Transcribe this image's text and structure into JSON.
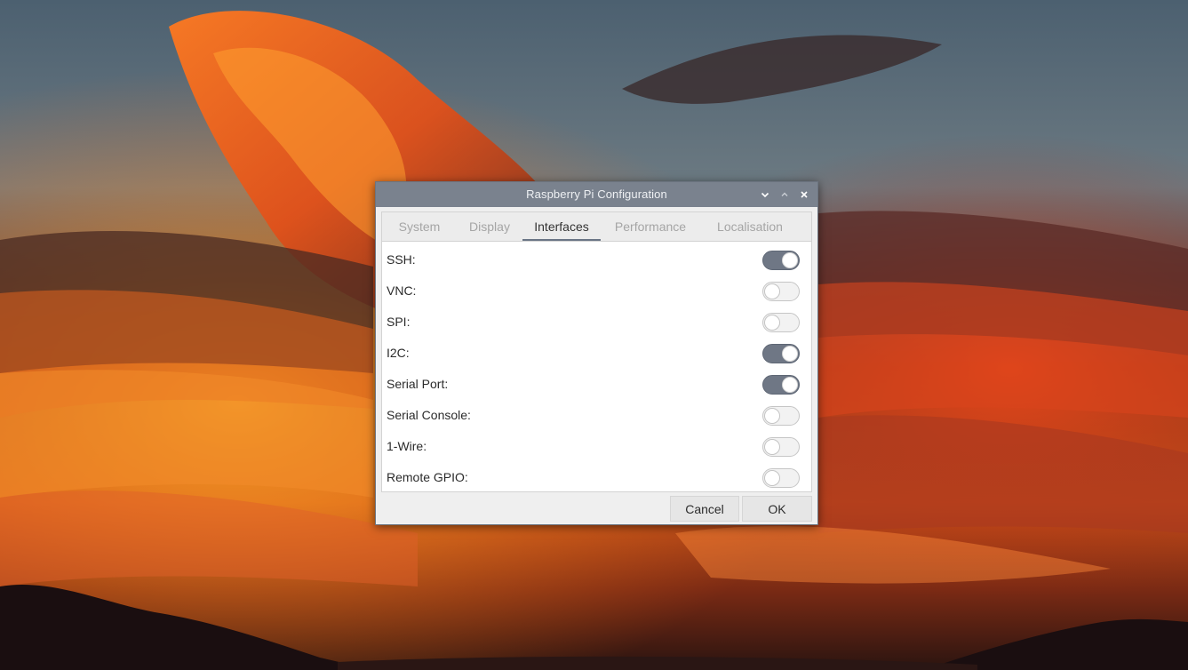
{
  "window": {
    "title": "Raspberry Pi Configuration",
    "controls": [
      "minimize",
      "maximize",
      "close"
    ]
  },
  "tabs": [
    {
      "label": "System",
      "active": false
    },
    {
      "label": "Display",
      "active": false
    },
    {
      "label": "Interfaces",
      "active": true
    },
    {
      "label": "Performance",
      "active": false
    },
    {
      "label": "Localisation",
      "active": false
    }
  ],
  "interfaces": [
    {
      "label": "SSH:",
      "enabled": true
    },
    {
      "label": "VNC:",
      "enabled": false
    },
    {
      "label": "SPI:",
      "enabled": false
    },
    {
      "label": "I2C:",
      "enabled": true
    },
    {
      "label": "Serial Port:",
      "enabled": true
    },
    {
      "label": "Serial Console:",
      "enabled": false
    },
    {
      "label": "1-Wire:",
      "enabled": false
    },
    {
      "label": "Remote GPIO:",
      "enabled": false
    }
  ],
  "buttons": {
    "cancel": "Cancel",
    "ok": "OK"
  },
  "colors": {
    "titlebar": "#7a828e",
    "switch_on": "#6f7785",
    "switch_off": "#f2f2f2",
    "active_tab_underline": "#6a7585"
  }
}
